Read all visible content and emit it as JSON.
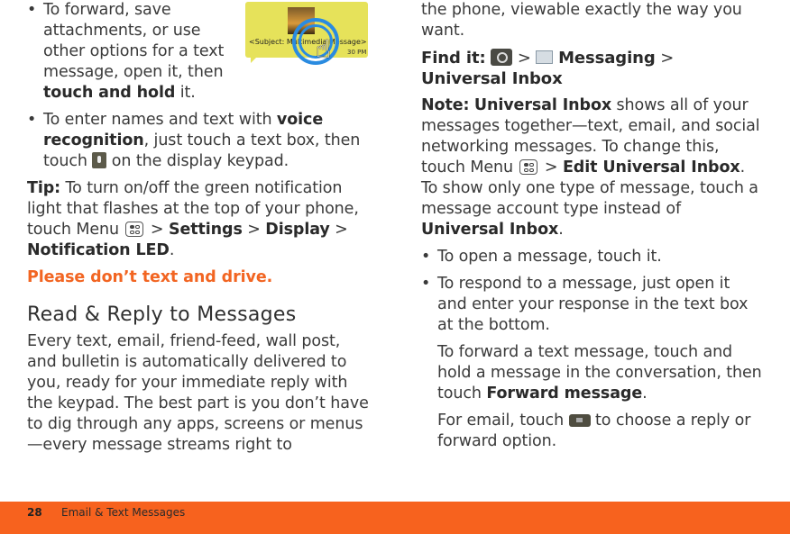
{
  "illustration": {
    "subject": "<Subject: Multimedia Message>",
    "time": "30 PM"
  },
  "left": {
    "bullet1": {
      "pre": "To forward, save attachments, or use other options for a text message, open it, then ",
      "bold": "touch and hold",
      "post": " it."
    },
    "bullet2": {
      "pre": "To enter names and text with ",
      "bold": "voice recognition",
      "mid": ", just touch a text box, then touch ",
      "post": " on the display keypad."
    },
    "tip": {
      "label": "Tip:",
      "text": " To turn on/off the green notification light that flashes at the top of your phone, touch Menu ",
      "sep1": " > ",
      "settings": "Settings",
      "sep2": " > ",
      "display": "Display",
      "sep3": " > ",
      "led": "Notification LED",
      "end": "."
    },
    "warning": "Please don’t text and drive.",
    "heading": "Read & Reply to Messages",
    "body": "Every text, email, friend-feed, wall post, and bulletin is automatically delivered to you, ready for your immediate reply with the keypad. The best part is you don’t have to dig through any apps, screens or menus—every message streams right to"
  },
  "right": {
    "cont": "the phone, viewable exactly the way you want.",
    "find": {
      "label": "Find it:",
      "sep1": " > ",
      "messaging": "Messaging",
      "sep2": " > ",
      "inbox": "Universal Inbox"
    },
    "note": {
      "label": "Note:",
      "bold": "Universal Inbox",
      "text": " shows all of your messages together—text, email, and social networking messages. To change this, touch Menu ",
      "sep": " > ",
      "edit": "Edit Universal Inbox",
      "text2": ". To show only one type of message, touch a message account type instead of ",
      "inbox": "Universal Inbox",
      "end": "."
    },
    "bullet1": "To open a message, touch it.",
    "bullet2": "To respond to a message, just open it and enter your response in the text box at the bottom.",
    "forward": {
      "pre": "To forward a text message, touch and hold a message in the conversation, then touch ",
      "bold": "Forward message",
      "end": "."
    },
    "email": {
      "pre": "For email, touch ",
      "post": " to choose a reply or forward option."
    }
  },
  "footer": {
    "page": "28",
    "section": "Email & Text Messages"
  }
}
